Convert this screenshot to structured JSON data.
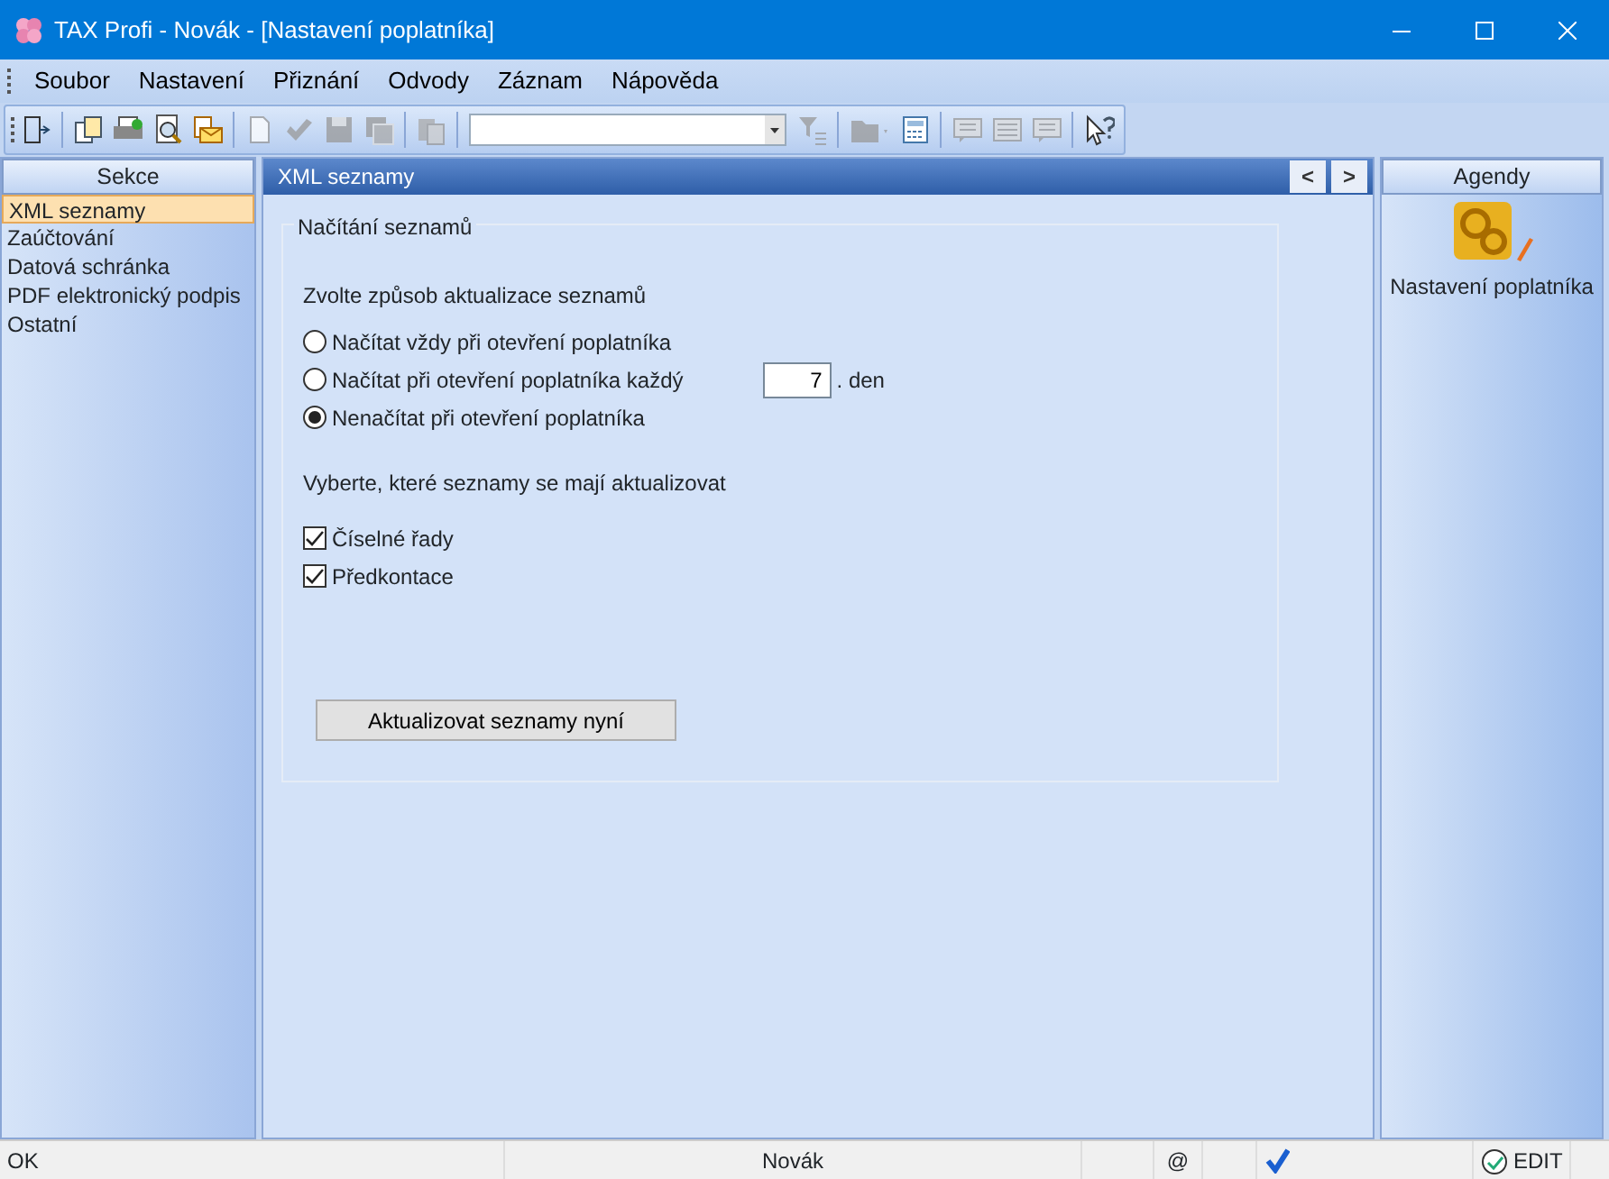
{
  "window": {
    "title": "TAX Profi - Novák - [Nastavení poplatníka]"
  },
  "menu": [
    "Soubor",
    "Nastavení",
    "Přiznání",
    "Odvody",
    "Záznam",
    "Nápověda"
  ],
  "toolbar": [
    {
      "kind": "exit",
      "disabled": false
    },
    {
      "kind": "sep"
    },
    {
      "kind": "copy",
      "disabled": false
    },
    {
      "kind": "print",
      "disabled": false
    },
    {
      "kind": "preview",
      "disabled": false
    },
    {
      "kind": "mail",
      "disabled": false
    },
    {
      "kind": "sep"
    },
    {
      "kind": "new",
      "disabled": true
    },
    {
      "kind": "check",
      "disabled": true
    },
    {
      "kind": "save",
      "disabled": true
    },
    {
      "kind": "saveall",
      "disabled": true
    },
    {
      "kind": "sep"
    },
    {
      "kind": "paste",
      "disabled": true
    },
    {
      "kind": "sep"
    },
    {
      "kind": "combo"
    },
    {
      "kind": "filter",
      "disabled": true
    },
    {
      "kind": "sep"
    },
    {
      "kind": "folder",
      "disabled": true
    },
    {
      "kind": "calc",
      "disabled": false
    },
    {
      "kind": "sep"
    },
    {
      "kind": "note",
      "disabled": true
    },
    {
      "kind": "list",
      "disabled": true
    },
    {
      "kind": "note",
      "disabled": true
    },
    {
      "kind": "sep"
    },
    {
      "kind": "help",
      "disabled": false
    }
  ],
  "sections": {
    "title": "Sekce",
    "items": [
      {
        "label": "XML seznamy",
        "selected": true
      },
      {
        "label": "Zaúčtování",
        "selected": false
      },
      {
        "label": "Datová schránka",
        "selected": false
      },
      {
        "label": "PDF elektronický podpis",
        "selected": false
      },
      {
        "label": "Ostatní",
        "selected": false
      }
    ]
  },
  "content": {
    "title": "XML seznamy",
    "nav": [
      "<",
      ">"
    ],
    "group": {
      "legend": "Načítání seznamů",
      "prompt": "Zvolte způsob aktualizace seznamů",
      "options": [
        {
          "label": "Načítat vždy při otevření poplatníka",
          "selected": false
        },
        {
          "label": "Načítat při otevření poplatníka každý",
          "selected": false,
          "value": "7",
          "suffix": ". den"
        },
        {
          "label": "Nenačítat při otevření poplatníka",
          "selected": true
        }
      ],
      "lists_prompt": "Vyberte, které seznamy se mají aktualizovat",
      "lists": [
        {
          "label": "Číselné řady",
          "checked": true
        },
        {
          "label": "Předkontace",
          "checked": true
        }
      ],
      "button": "Aktualizovat seznamy nyní"
    }
  },
  "agendas": {
    "title": "Agendy",
    "items": [
      {
        "label": "Nastavení poplatníka"
      }
    ]
  },
  "status_bar": {
    "left": "OK",
    "user": "Novák",
    "at": "@",
    "mode": "EDIT"
  }
}
